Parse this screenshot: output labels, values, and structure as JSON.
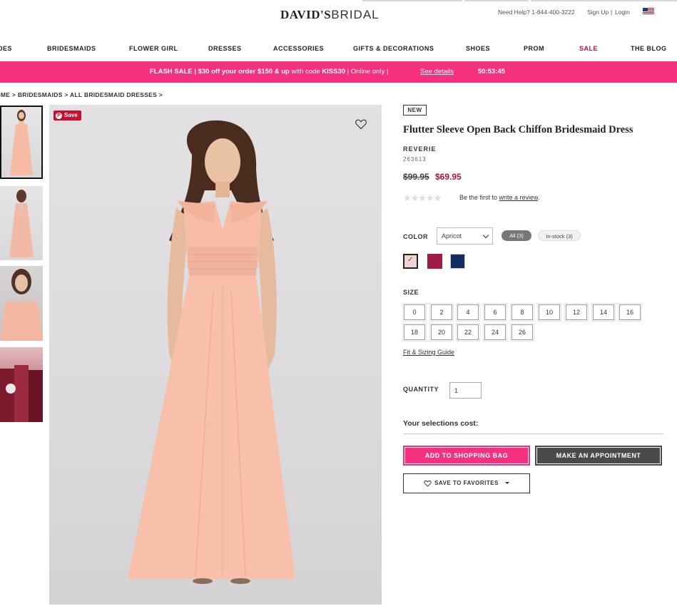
{
  "header": {
    "logo_primary": "DAVID'S",
    "logo_secondary": "BRIDAL",
    "help": "Need Help? 1-844-400-3222",
    "sign_up": "Sign Up",
    "separator": "|",
    "login": "Login",
    "flag_icon": "us-flag-icon"
  },
  "nav": {
    "items": [
      "DES",
      "BRIDESMAIDS",
      "FLOWER GIRL",
      "DRESSES",
      "ACCESSORIES",
      "GIFTS & DECORATIONS",
      "SHOES",
      "PROM",
      "SALE",
      "THE BLOG"
    ]
  },
  "banner": {
    "lead": "FLASH SALE | $30 off your order $150 & up",
    "middle": " with code ",
    "code": "KISS30",
    "tail": " | Online only | ",
    "link": "See details",
    "timer": "50:53:45"
  },
  "breadcrumb": {
    "items": [
      "OME >",
      "BRIDESMAIDS >",
      "ALL BRIDESMAID DRESSES >"
    ]
  },
  "image": {
    "save_label": "Save"
  },
  "product": {
    "badge": "NEW",
    "title": "Flutter Sleeve Open Back Chiffon Bridesmaid Dress",
    "brand": "REVERIE",
    "sku": "263613",
    "price_original": "$99.95",
    "price_sale": "$69.95",
    "stars": "★★★★★",
    "review_prefix": "Be the first to ",
    "review_link": "write a review",
    "review_suffix": "."
  },
  "color": {
    "label": "COLOR",
    "selected": "Apricot",
    "filter_all": "All (3)",
    "filter_in_stock": "In-stock (3)",
    "swatches": [
      {
        "name": "Apricot",
        "hex": "#f0d3cf"
      },
      {
        "name": "Wine",
        "hex": "#9e1c45"
      },
      {
        "name": "Navy",
        "hex": "#142d5e"
      }
    ]
  },
  "size": {
    "label": "SIZE",
    "row1": [
      "0",
      "2",
      "4",
      "6",
      "8",
      "10",
      "12",
      "14",
      "16"
    ],
    "row2": [
      "18",
      "20",
      "22",
      "24",
      "26"
    ],
    "fit_guide": "Fit & Sizing Guide"
  },
  "quantity": {
    "label": "QUANTITY",
    "value": "1"
  },
  "cost_label": "Your selections cost:",
  "buttons": {
    "add_to_bag": "ADD TO SHOPPING BAG",
    "appointment": "MAKE AN APPOINTMENT",
    "save_favorites": "SAVE TO FAVORITES"
  },
  "colors": {
    "brand_pink": "#f5317f",
    "sale_red": "#b0123a",
    "dark_button": "#4a4a4a"
  }
}
